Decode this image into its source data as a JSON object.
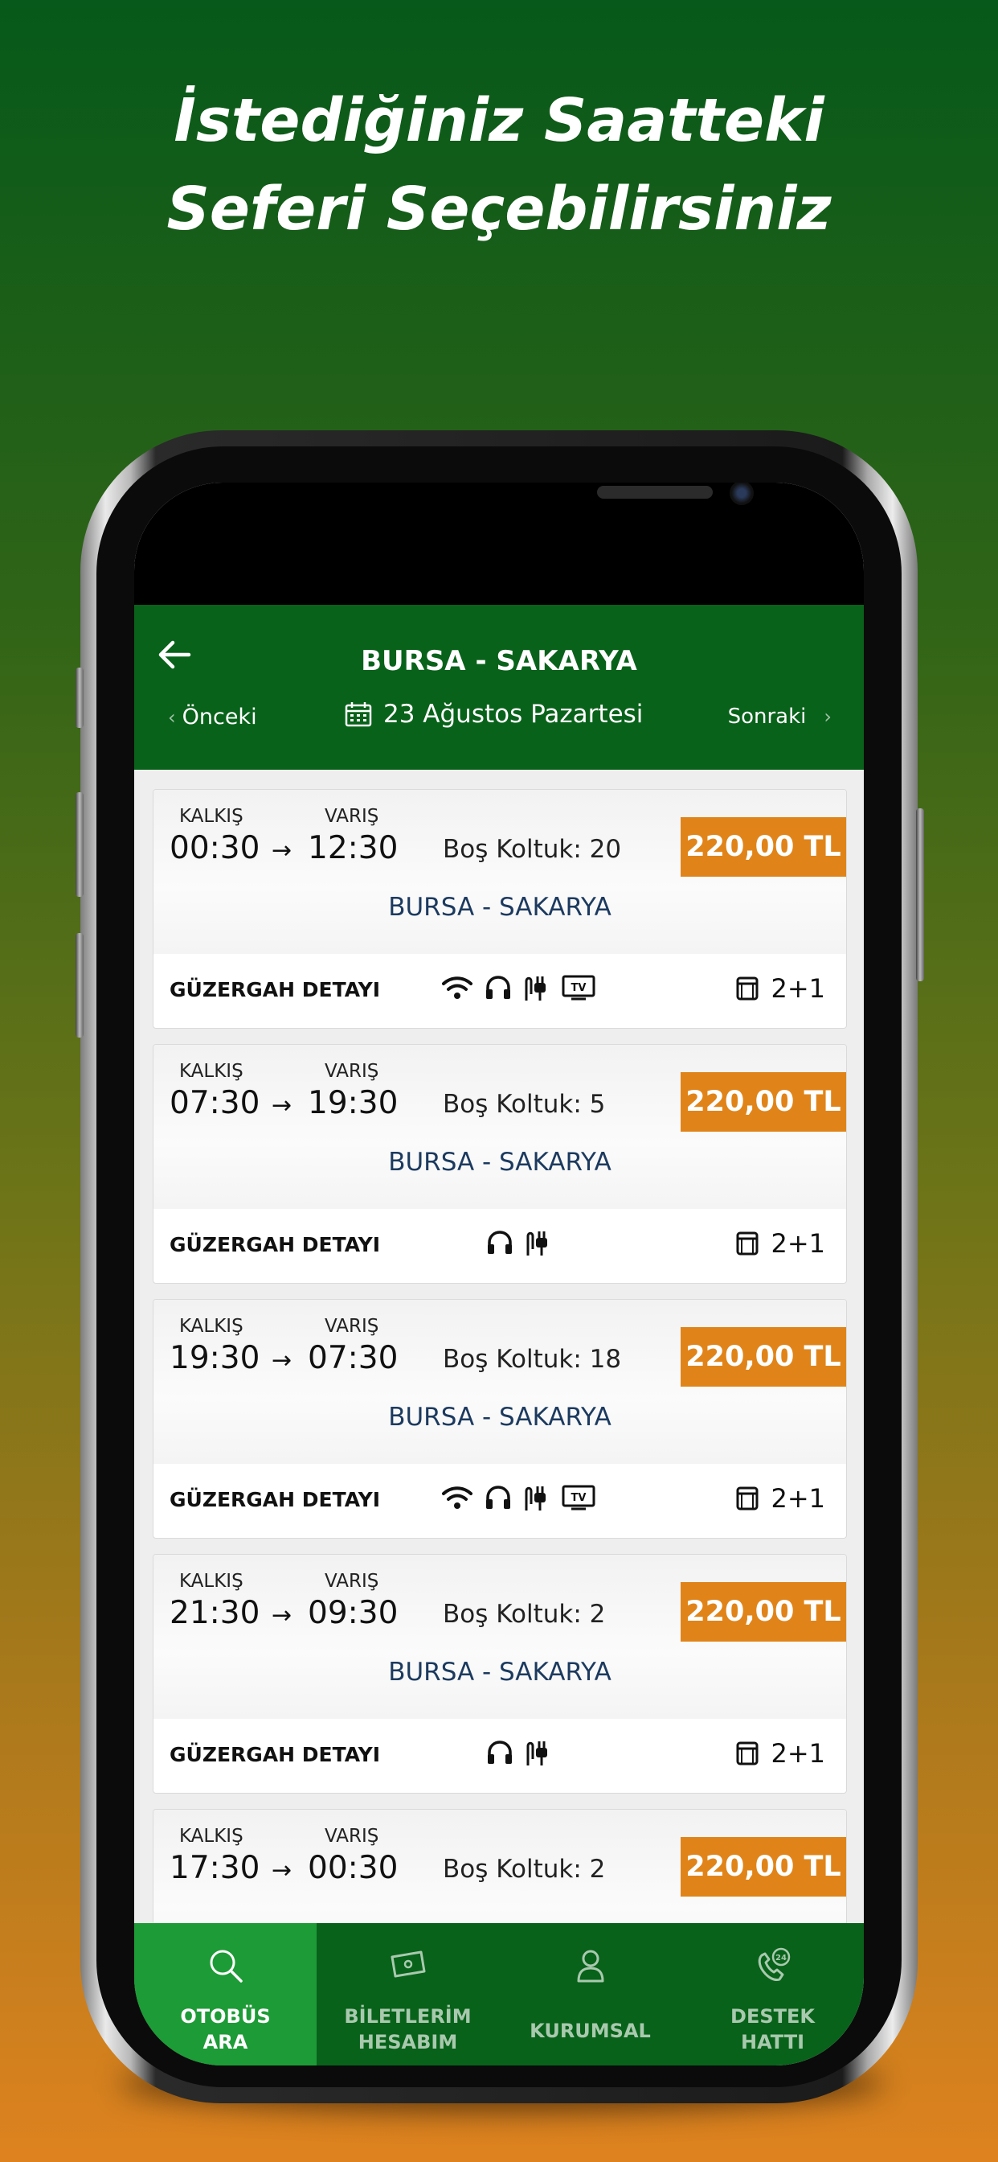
{
  "headline": {
    "line1": "İstediğiniz Saatteki",
    "line2": "Seferi Seçebilirsiniz"
  },
  "header": {
    "title": "BURSA - SAKARYA",
    "prev_label": "Önceki",
    "next_label": "Sonraki",
    "date": "23 Ağustos Pazartesi"
  },
  "labels": {
    "departure": "KALKIŞ",
    "arrival": "VARIŞ",
    "seats_prefix": "Boş Koltuk:",
    "route_detail": "GÜZERGAH DETAYI"
  },
  "trips": [
    {
      "dep": "00:30",
      "arr": "12:30",
      "seats": "20",
      "price": "220,00 TL",
      "route": "BURSA - SAKARYA",
      "layout": "2+1",
      "amenities": [
        "wifi-icon",
        "headphones-icon",
        "power-plug-icon",
        "tv-icon"
      ]
    },
    {
      "dep": "07:30",
      "arr": "19:30",
      "seats": "5",
      "price": "220,00 TL",
      "route": "BURSA - SAKARYA",
      "layout": "2+1",
      "amenities": [
        "headphones-icon",
        "power-plug-icon"
      ]
    },
    {
      "dep": "19:30",
      "arr": "07:30",
      "seats": "18",
      "price": "220,00 TL",
      "route": "BURSA - SAKARYA",
      "layout": "2+1",
      "amenities": [
        "wifi-icon",
        "headphones-icon",
        "power-plug-icon",
        "tv-icon"
      ]
    },
    {
      "dep": "21:30",
      "arr": "09:30",
      "seats": "2",
      "price": "220,00 TL",
      "route": "BURSA - SAKARYA",
      "layout": "2+1",
      "amenities": [
        "headphones-icon",
        "power-plug-icon"
      ]
    },
    {
      "dep": "17:30",
      "arr": "00:30",
      "seats": "2",
      "price": "220,00 TL"
    }
  ],
  "tv_text": "TV",
  "tabs": [
    {
      "line1": "OTOBÜS",
      "line2": "ARA",
      "icon": "search-icon",
      "active": true
    },
    {
      "line1": "BİLETLERİM",
      "line2": "HESABIM",
      "icon": "ticket-icon"
    },
    {
      "line1": "KURUMSAL",
      "line2": "",
      "icon": "user-icon"
    },
    {
      "line1": "DESTEK",
      "line2": "HATTI",
      "icon": "support-24-icon"
    }
  ],
  "colors": {
    "primary": "#08621a",
    "active_tab": "#1d9b36",
    "price": "#e08419",
    "route_text": "#1c3a5f"
  }
}
